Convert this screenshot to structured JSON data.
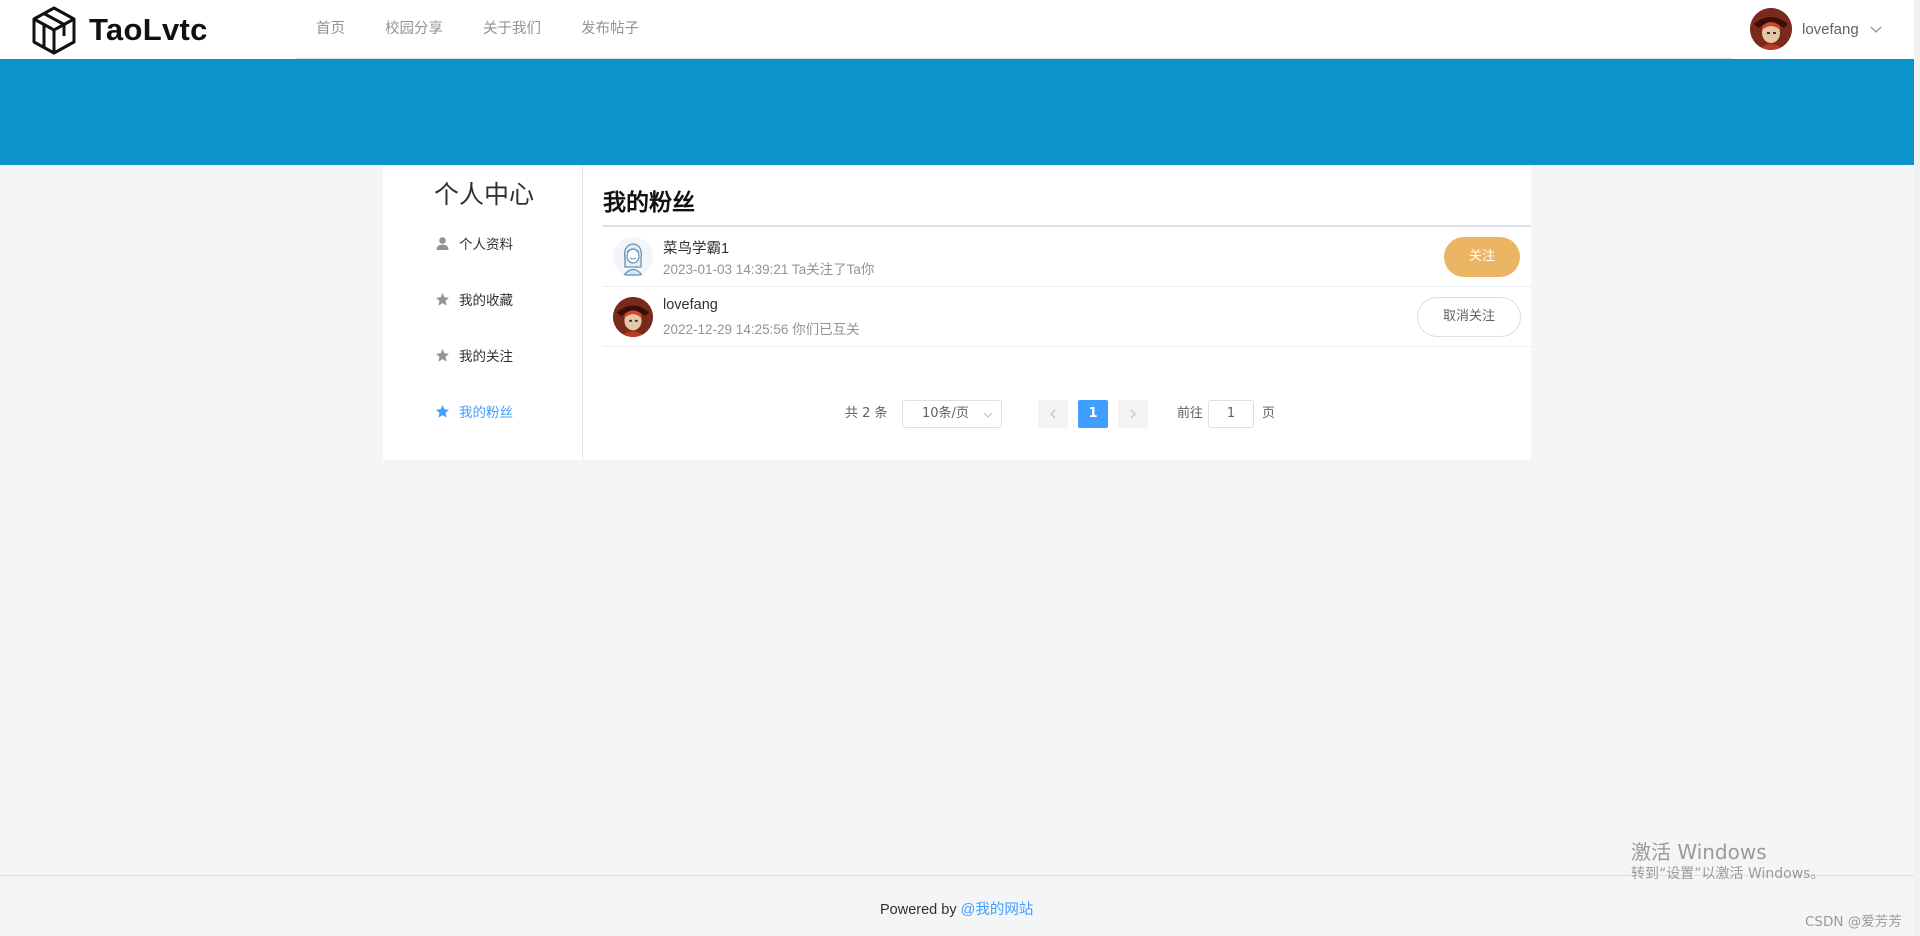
{
  "header": {
    "brand": "TaoLvtc",
    "nav": [
      {
        "label": "首页"
      },
      {
        "label": "校园分享"
      },
      {
        "label": "关于我们"
      },
      {
        "label": "发布帖子"
      }
    ],
    "user": {
      "name": "lovefang"
    }
  },
  "sidebar": {
    "title": "个人中心",
    "items": [
      {
        "label": "个人资料",
        "icon": "user-icon",
        "active": false
      },
      {
        "label": "我的收藏",
        "icon": "star-icon",
        "active": false
      },
      {
        "label": "我的关注",
        "icon": "star-icon",
        "active": false
      },
      {
        "label": "我的粉丝",
        "icon": "star-icon",
        "active": true
      }
    ]
  },
  "main": {
    "title": "我的粉丝",
    "fans": [
      {
        "name": "菜鸟学霸1",
        "meta": "2023-01-03 14:39:21 Ta关注了Ta你",
        "action": "关注",
        "avatar": "girl-avatar"
      },
      {
        "name": "lovefang",
        "meta": "2022-12-29 14:25:56 你们已互关",
        "action": "取消关注",
        "avatar": "character-avatar"
      }
    ]
  },
  "pagination": {
    "total": "共 2 条",
    "page_size": "10条/页",
    "current": "1",
    "goto_label": "前往",
    "goto_value": "1",
    "page_label": "页"
  },
  "footer": {
    "prefix": "Powered by ",
    "link": "@我的网站"
  },
  "watermark": {
    "title": "激活 Windows",
    "subtitle": "转到“设置”以激活 Windows。",
    "credit": "CSDN @爱芳芳"
  },
  "colors": {
    "banner": "#0b93cb",
    "accent": "#409eff",
    "follow": "#ebb563"
  }
}
